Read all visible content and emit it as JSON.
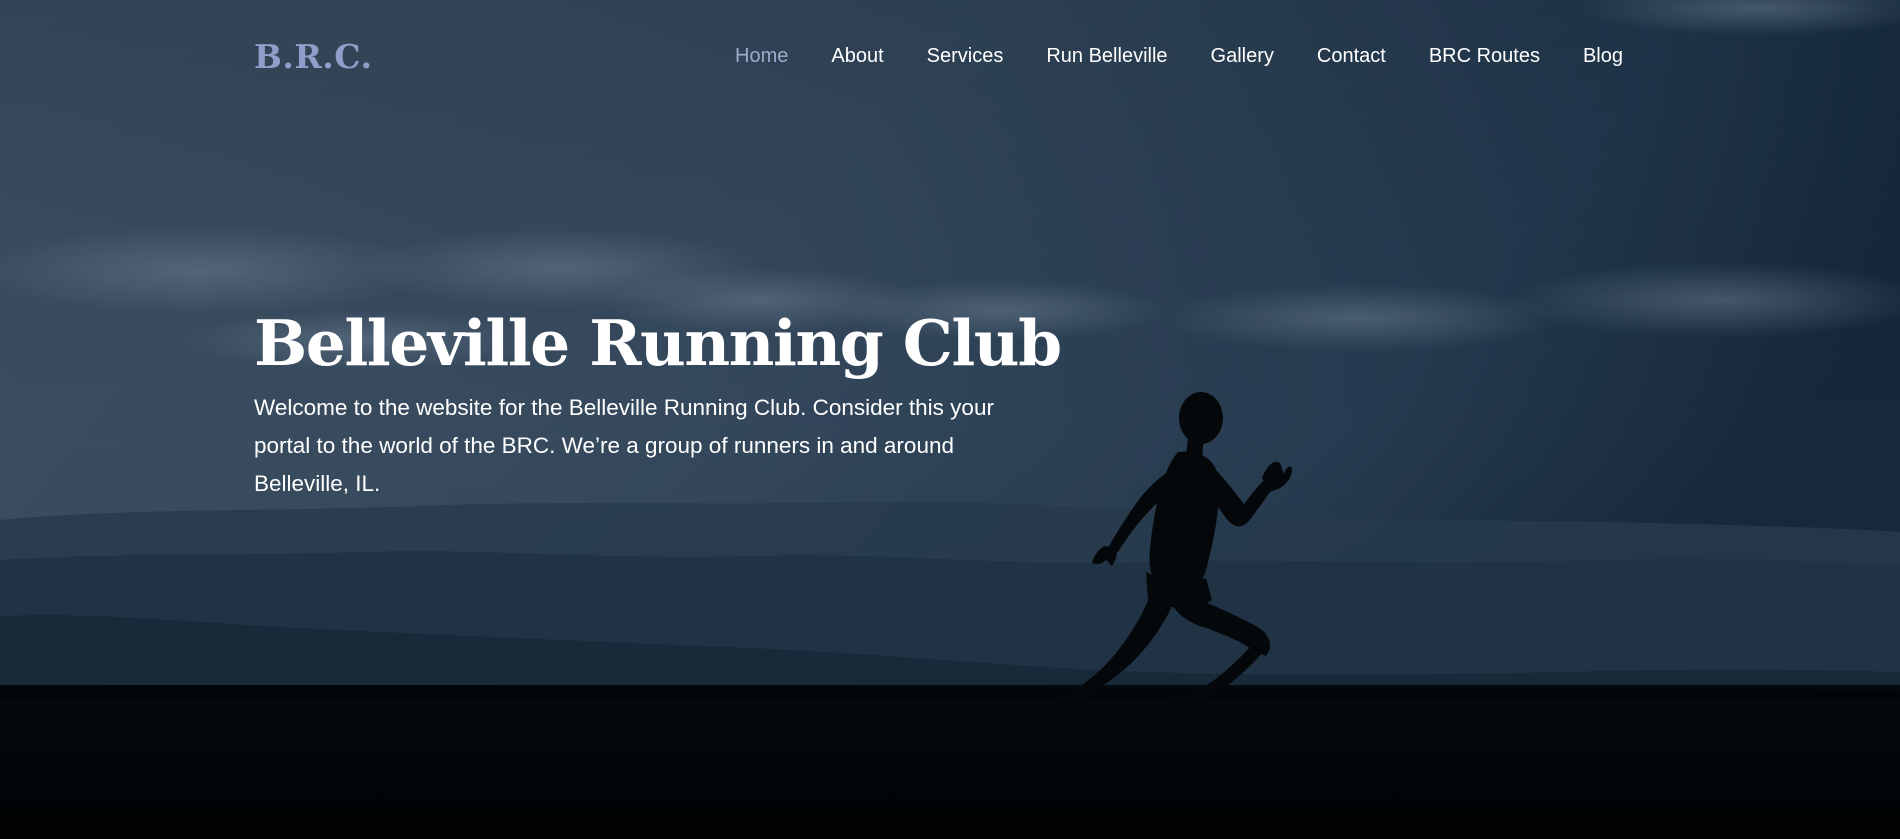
{
  "site": {
    "logo_text": "B.R.C."
  },
  "nav": {
    "items": [
      {
        "label": "Home",
        "active": true
      },
      {
        "label": "About"
      },
      {
        "label": "Services"
      },
      {
        "label": "Run Belleville"
      },
      {
        "label": "Gallery"
      },
      {
        "label": "Contact"
      },
      {
        "label": "BRC Routes"
      },
      {
        "label": "Blog"
      }
    ]
  },
  "hero": {
    "title": "Belleville Running Club",
    "description": "Welcome to the website for the Belleville Running Club. Consider this your portal to the world of the BRC. We’re a group of runners in and around Belleville, IL."
  },
  "colors": {
    "logo": "#8f9fc9",
    "nav_text": "#ffffff",
    "nav_active": "#9eaccc",
    "sky_dark": "#0f2236",
    "sky_light": "#4a5e75",
    "ground": "#010203"
  },
  "icons": {
    "background": "runner-silhouette-hero-image"
  }
}
